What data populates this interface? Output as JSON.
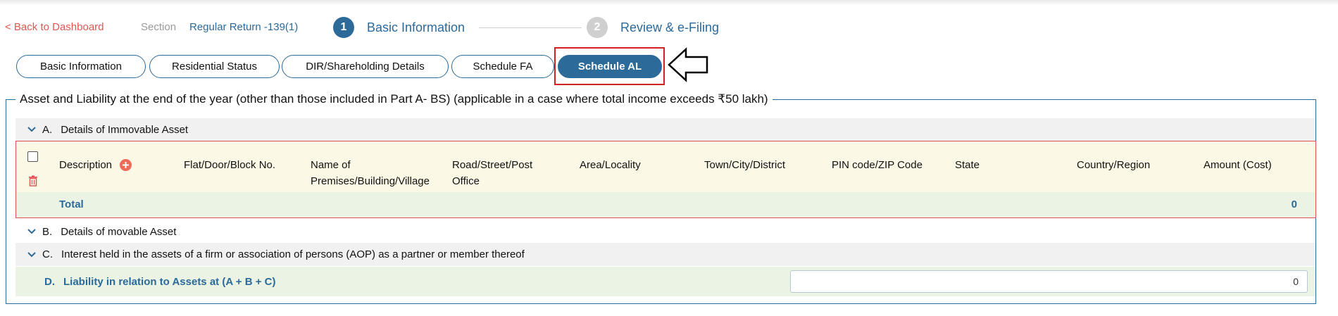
{
  "header": {
    "back_link": "< Back to Dashboard",
    "section_label": "Section",
    "section_value": "Regular Return -139(1)",
    "steps": [
      {
        "num": "1",
        "label": "Basic Information"
      },
      {
        "num": "2",
        "label": "Review & e-Filing"
      }
    ]
  },
  "tabs": [
    {
      "label": "Basic Information"
    },
    {
      "label": "Residential Status"
    },
    {
      "label": "DIR/Shareholding Details"
    },
    {
      "label": "Schedule FA"
    },
    {
      "label": "Schedule AL"
    }
  ],
  "active_tab": "Schedule AL",
  "panel": {
    "title": "Asset and Liability at the end of the year (other than those included in Part A- BS) (applicable in a case where total income exceeds ₹50 lakh)",
    "sectionA": {
      "letter": "A.",
      "title": "Details of Immovable Asset"
    },
    "tableA": {
      "columns": [
        "Description",
        "Flat/Door/Block No.",
        "Name of Premises/Building/Village",
        "Road/Street/Post Office",
        "Area/Locality",
        "Town/City/District",
        "PIN code/ZIP Code",
        "State",
        "Country/Region",
        "Amount (Cost)"
      ],
      "total_label": "Total",
      "total_value": "0"
    },
    "sectionB": {
      "letter": "B.",
      "title": "Details of movable Asset"
    },
    "sectionC": {
      "letter": "C.",
      "title": "Interest held in the assets of a firm or association of persons (AOP) as a partner or member thereof"
    },
    "sectionD": {
      "letter": "D.",
      "title": "Liability in relation to Assets at (A + B + C)",
      "value": "0"
    }
  },
  "colors": {
    "primary": "#2c6a9a",
    "back_link": "#e0574f",
    "highlight": "#d62020",
    "header_row_bg": "#fbf9e6",
    "total_row_bg": "#eaf3e4",
    "plus_icon": "#f06a5a"
  }
}
